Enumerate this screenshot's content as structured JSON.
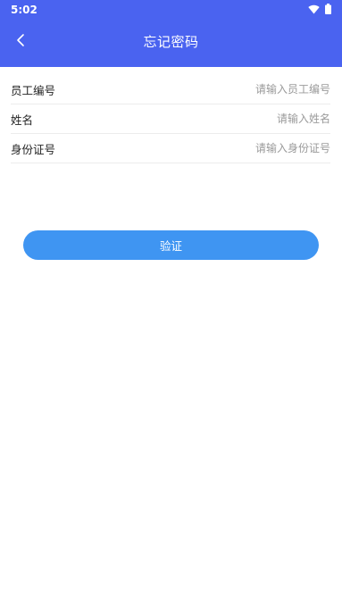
{
  "status_bar": {
    "time": "5:02",
    "icons": [
      "wifi-icon",
      "battery-icon"
    ]
  },
  "header": {
    "title": "忘记密码",
    "back_icon": "chevron-left-icon",
    "background_color": "#4a63f0"
  },
  "form": {
    "fields": [
      {
        "label": "员工编号",
        "placeholder": "请输入员工编号",
        "value": ""
      },
      {
        "label": "姓名",
        "placeholder": "请输入姓名",
        "value": ""
      },
      {
        "label": "身份证号",
        "placeholder": "请输入身份证号",
        "value": ""
      }
    ]
  },
  "actions": {
    "verify_label": "验证",
    "verify_color": "#3f95f2"
  }
}
